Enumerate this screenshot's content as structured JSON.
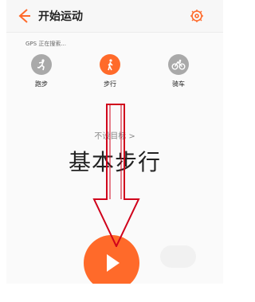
{
  "header": {
    "title": "开始运动"
  },
  "status": {
    "gps": "GPS 正在搜索..."
  },
  "modes": [
    {
      "label": "跑步",
      "icon": "running-icon"
    },
    {
      "label": "步行",
      "icon": "walking-icon"
    },
    {
      "label": "骑车",
      "icon": "bike-icon"
    }
  ],
  "goal": {
    "text": "不设目标",
    "chevron": ">"
  },
  "main": {
    "mode_title": "基本步行"
  },
  "colors": {
    "accent": "#ff6a2a",
    "inactive": "#a9a9a9",
    "annotation": "#d0021b"
  }
}
